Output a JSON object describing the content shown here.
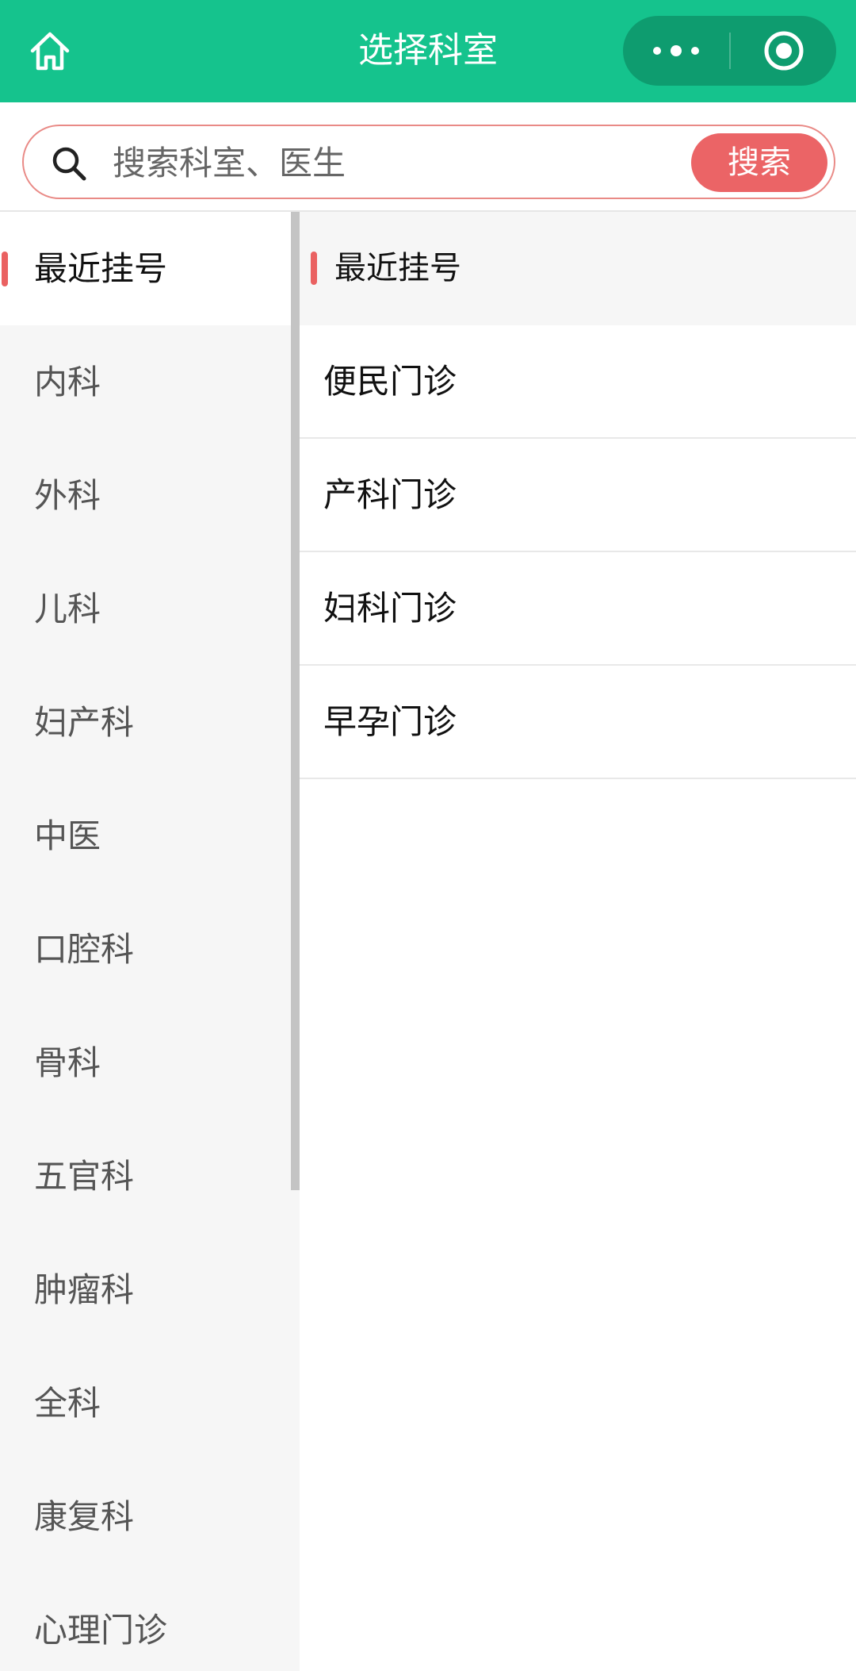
{
  "header": {
    "title": "选择科室",
    "bg_color": "#15c38d",
    "home_icon": "home-icon",
    "more_icon": "more-dots-icon",
    "close_icon": "target-circle-icon"
  },
  "search": {
    "placeholder": "搜索科室、医生",
    "button_label": "搜索",
    "accent_color": "#eb6466"
  },
  "categories": [
    {
      "label": "最近挂号",
      "active": true
    },
    {
      "label": "内科"
    },
    {
      "label": "外科"
    },
    {
      "label": "儿科"
    },
    {
      "label": "妇产科"
    },
    {
      "label": "中医"
    },
    {
      "label": "口腔科"
    },
    {
      "label": "骨科"
    },
    {
      "label": "五官科"
    },
    {
      "label": "肿瘤科"
    },
    {
      "label": "全科"
    },
    {
      "label": "康复科"
    },
    {
      "label": "心理门诊"
    }
  ],
  "right": {
    "group_title": "最近挂号",
    "clinics": [
      "便民门诊",
      "产科门诊",
      "妇科门诊",
      "早孕门诊"
    ]
  }
}
